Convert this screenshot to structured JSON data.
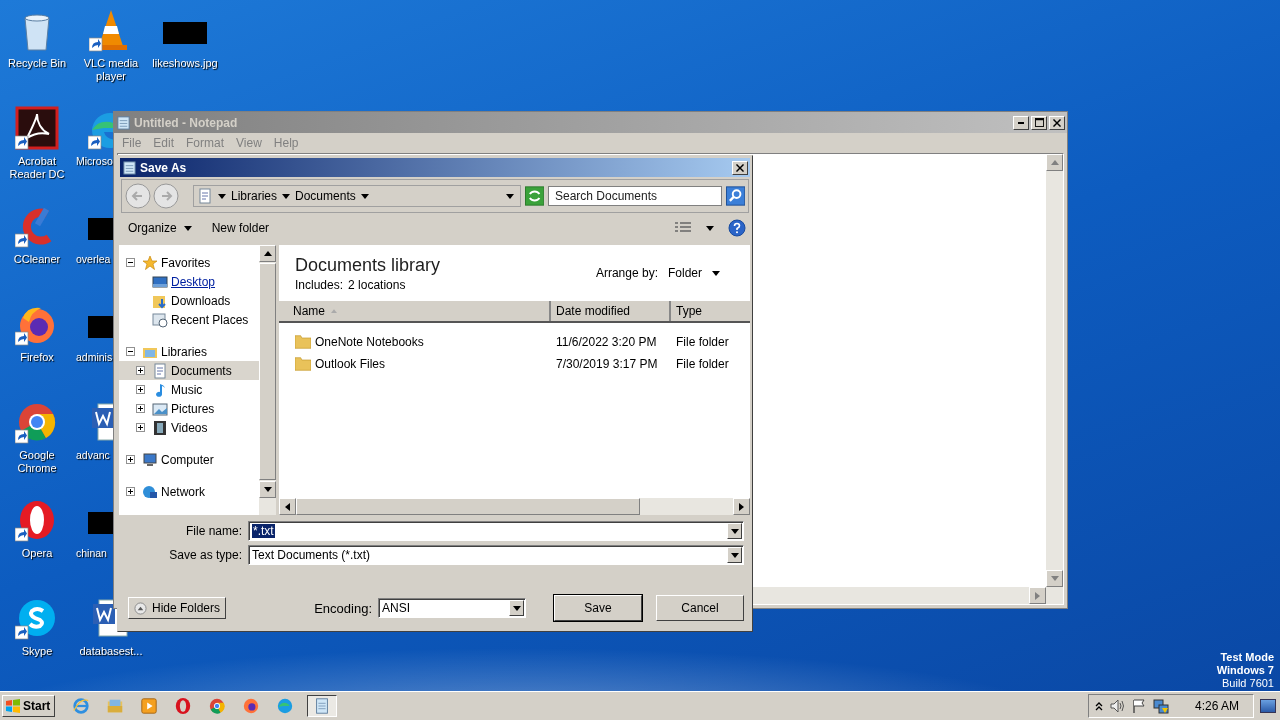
{
  "desktop": {
    "columns": [
      [
        {
          "label": "Recycle Bin",
          "kind": "recycle",
          "shortcut": false
        },
        {
          "label": "Acrobat Reader DC",
          "kind": "acrobat",
          "shortcut": true
        },
        {
          "label": "CCleaner",
          "kind": "ccleaner",
          "shortcut": true
        },
        {
          "label": "Firefox",
          "kind": "firefox",
          "shortcut": true
        },
        {
          "label": "Google Chrome",
          "kind": "chrome",
          "shortcut": true
        },
        {
          "label": "Opera",
          "kind": "opera",
          "shortcut": true
        },
        {
          "label": "Skype",
          "kind": "skype",
          "shortcut": true
        }
      ],
      [
        {
          "label": "VLC media player",
          "kind": "vlc",
          "shortcut": true
        },
        {
          "label": "Microso",
          "kind": "edge",
          "shortcut": true
        },
        {
          "label": "overlea",
          "kind": "redacted",
          "shortcut": false
        },
        {
          "label": "adminis",
          "kind": "redacted",
          "shortcut": false
        },
        {
          "label": "advanc",
          "kind": "word",
          "shortcut": false
        },
        {
          "label": "chinan",
          "kind": "redacted",
          "shortcut": false
        },
        {
          "label": "databasest...",
          "kind": "word",
          "shortcut": false
        }
      ],
      [
        {
          "label": "likeshows.jpg",
          "kind": "redacted",
          "shortcut": false
        }
      ]
    ]
  },
  "notepad": {
    "title": "Untitled - Notepad",
    "active": false,
    "menu": [
      "File",
      "Edit",
      "Format",
      "View",
      "Help"
    ]
  },
  "dialog": {
    "title": "Save As",
    "breadcrumb": [
      "Libraries",
      "Documents"
    ],
    "search": {
      "placeholder": "Search Documents"
    },
    "toolbar": [
      "Organize",
      "New folder"
    ],
    "tree": [
      {
        "label": "Favorites",
        "kind": "star",
        "expanded": true,
        "selected": false,
        "hovered": false,
        "children": [
          {
            "label": "Desktop",
            "kind": "desktop",
            "selected": false,
            "hovered": true
          },
          {
            "label": "Downloads",
            "kind": "downloads",
            "selected": false,
            "hovered": false
          },
          {
            "label": "Recent Places",
            "kind": "recent",
            "selected": false,
            "hovered": false
          }
        ]
      },
      {
        "label": "Libraries",
        "kind": "library",
        "expanded": true,
        "selected": false,
        "hovered": false,
        "children": [
          {
            "label": "Documents",
            "kind": "document",
            "expanded": false,
            "selected": true,
            "hovered": false
          },
          {
            "label": "Music",
            "kind": "music",
            "expanded": false,
            "selected": false,
            "hovered": false
          },
          {
            "label": "Pictures",
            "kind": "pictures",
            "expanded": false,
            "selected": false,
            "hovered": false
          },
          {
            "label": "Videos",
            "kind": "videos",
            "expanded": false,
            "selected": false,
            "hovered": false
          }
        ]
      },
      {
        "label": "Computer",
        "kind": "computer",
        "expanded": false,
        "selected": false,
        "hovered": false
      },
      {
        "label": "Network",
        "kind": "network",
        "expanded": false,
        "selected": false,
        "hovered": false
      }
    ],
    "library": {
      "title": "Documents library",
      "includes_label": "Includes:",
      "includes_link": "2 locations",
      "arrange_label": "Arrange by:",
      "arrange_value": "Folder"
    },
    "columns": [
      "Name",
      "Date modified",
      "Type"
    ],
    "rows": [
      [
        "OneNote Notebooks",
        "11/6/2022 3:20 PM",
        "File folder"
      ],
      [
        "Outlook Files",
        "7/30/2019 3:17 PM",
        "File folder"
      ]
    ],
    "file_name_label": "File name:",
    "file_name": "*.txt",
    "type_label": "Save as type:",
    "type_value": "Text Documents (*.txt)",
    "hide_folders": "Hide Folders",
    "encoding_label": "Encoding:",
    "encoding": "ANSI",
    "buttons": [
      "Save",
      "Cancel"
    ]
  },
  "taskbar": {
    "start": "Start",
    "items": [
      {
        "kind": "ie",
        "active": false
      },
      {
        "kind": "explorer",
        "active": false
      },
      {
        "kind": "media",
        "active": false
      },
      {
        "kind": "opera",
        "active": false
      },
      {
        "kind": "chrome",
        "active": false
      },
      {
        "kind": "firefox",
        "active": false
      },
      {
        "kind": "edge",
        "active": false
      },
      {
        "kind": "notepad",
        "active": true
      }
    ],
    "time": "4:26 AM"
  },
  "watermark": [
    "Test Mode",
    "Windows 7",
    "Build 7601"
  ]
}
